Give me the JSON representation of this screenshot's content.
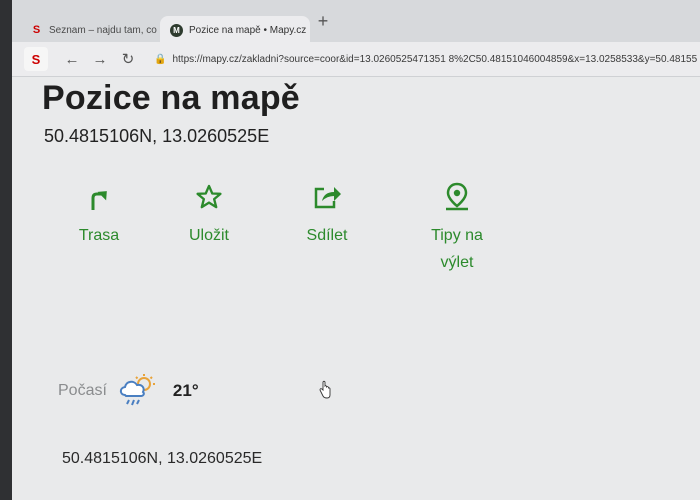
{
  "browser": {
    "tabs": [
      {
        "title": "Seznam – najdu tam, co neznám",
        "favicon": "seznam-icon",
        "active": false
      },
      {
        "title": "Pozice na mapě • Mapy.cz",
        "favicon": "mapy-icon",
        "active": true
      }
    ],
    "new_tab_label": "+",
    "url": "https://mapy.cz/zakladni?source=coor&id=13.0260525471351 8%2C50.48151046004859&x=13.0258533&y=50.48155"
  },
  "page": {
    "title": "Pozice na mapě",
    "coordinates": "50.4815106N, 13.0260525E",
    "actions": [
      {
        "label": "Trasa",
        "icon": "route-icon"
      },
      {
        "label": "Uložit",
        "icon": "star-icon"
      },
      {
        "label": "Sdílet",
        "icon": "share-icon"
      },
      {
        "label": "Tipy na výlet",
        "icon": "location-pin-icon"
      }
    ],
    "weather": {
      "label": "Počasí",
      "temperature": "21°",
      "icon": "rain-cloud-sun-icon"
    },
    "coordinates_bottom": "50.4815106N, 13.0260525E"
  },
  "colors": {
    "accent": "#2c8a2c",
    "page_bg": "#e9eaeb",
    "tab_strip": "#d7d9dc"
  }
}
